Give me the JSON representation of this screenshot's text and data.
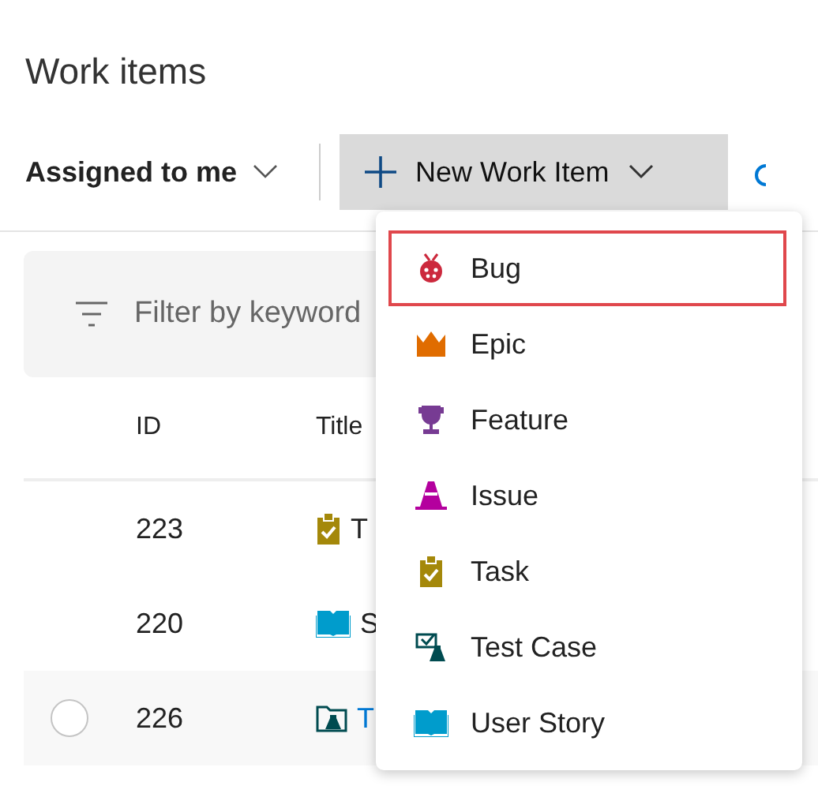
{
  "page": {
    "title": "Work items"
  },
  "toolbar": {
    "filter_menu": "Assigned to me",
    "new_button": "New Work Item"
  },
  "filter": {
    "placeholder": "Filter by keyword"
  },
  "table": {
    "columns": [
      "ID",
      "Title"
    ],
    "rows": [
      {
        "id": "223",
        "kind": "task",
        "title": "T",
        "hovered": false
      },
      {
        "id": "220",
        "kind": "story",
        "title": "S",
        "hovered": false
      },
      {
        "id": "226",
        "kind": "testplan",
        "title": "T",
        "hovered": true
      }
    ]
  },
  "menu": {
    "items": [
      {
        "label": "Bug",
        "kind": "bug",
        "selected": true
      },
      {
        "label": "Epic",
        "kind": "epic",
        "selected": false
      },
      {
        "label": "Feature",
        "kind": "feature",
        "selected": false
      },
      {
        "label": "Issue",
        "kind": "issue",
        "selected": false
      },
      {
        "label": "Task",
        "kind": "task",
        "selected": false
      },
      {
        "label": "Test Case",
        "kind": "testcase",
        "selected": false
      },
      {
        "label": "User Story",
        "kind": "story",
        "selected": false
      }
    ]
  }
}
